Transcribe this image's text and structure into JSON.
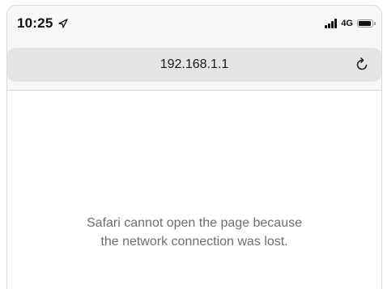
{
  "status_bar": {
    "time": "10:25",
    "location_icon": "location-arrow-icon",
    "network": "4G",
    "signal_icon": "cellular-signal-icon",
    "battery_icon": "battery-icon"
  },
  "address_bar": {
    "url": "192.168.1.1",
    "reload_icon": "reload-icon"
  },
  "error": {
    "line1": "Safari cannot open the page because",
    "line2": "the network connection was lost."
  }
}
